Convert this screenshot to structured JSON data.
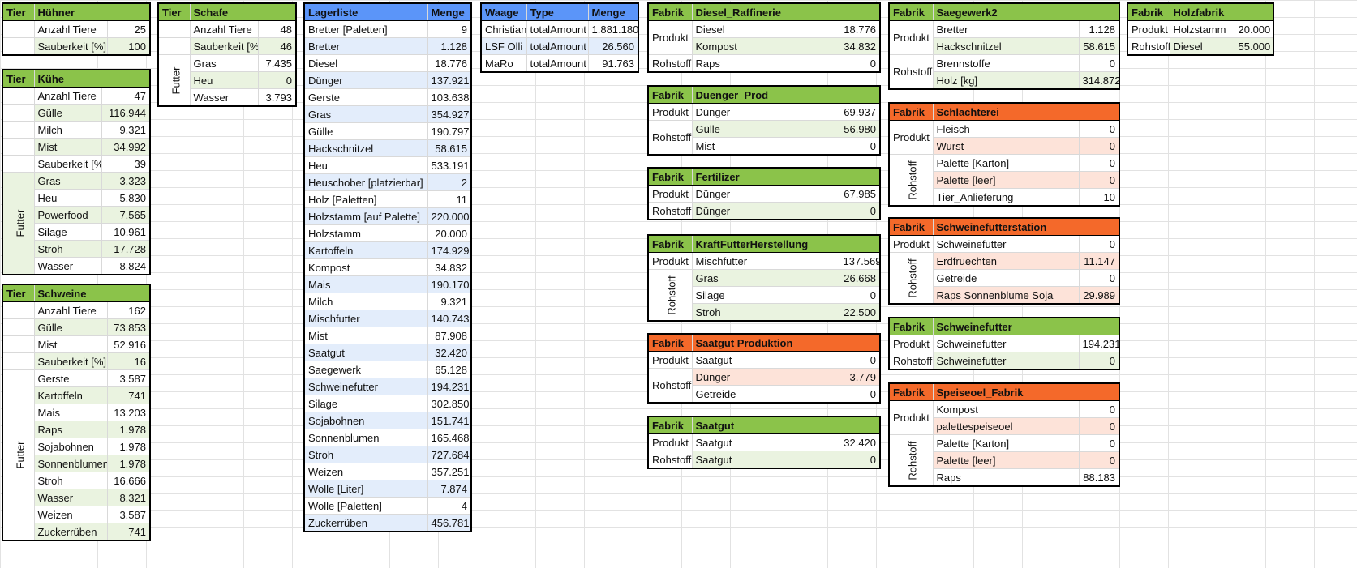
{
  "huehner": {
    "h1": "Tier",
    "h2": "Hühner",
    "rows": [
      [
        "Anzahl Tiere",
        "25"
      ],
      [
        "Sauberkeit [%]",
        "100"
      ]
    ]
  },
  "kuehe": {
    "h1": "Tier",
    "h2": "Kühe",
    "rows": [
      [
        "Anzahl Tiere",
        "47"
      ],
      [
        "Gülle",
        "116.944"
      ],
      [
        "Milch",
        "9.321"
      ],
      [
        "Mist",
        "34.992"
      ],
      [
        "Sauberkeit [%]",
        "39"
      ]
    ],
    "futter_label": "Futter",
    "futter": [
      [
        "Gras",
        "3.323"
      ],
      [
        "Heu",
        "5.830"
      ],
      [
        "Powerfood",
        "7.565"
      ],
      [
        "Silage",
        "10.961"
      ],
      [
        "Stroh",
        "17.728"
      ],
      [
        "Wasser",
        "8.824"
      ]
    ]
  },
  "schweine": {
    "h1": "Tier",
    "h2": "Schweine",
    "rows": [
      [
        "Anzahl Tiere",
        "162"
      ],
      [
        "Gülle",
        "73.853"
      ],
      [
        "Mist",
        "52.916"
      ],
      [
        "Sauberkeit [%]",
        "16"
      ]
    ],
    "futter_label": "Futter",
    "futter": [
      [
        "Gerste",
        "3.587"
      ],
      [
        "Kartoffeln",
        "741"
      ],
      [
        "Mais",
        "13.203"
      ],
      [
        "Raps",
        "1.978"
      ],
      [
        "Sojabohnen",
        "1.978"
      ],
      [
        "Sonnenblumen",
        "1.978"
      ],
      [
        "Stroh",
        "16.666"
      ],
      [
        "Wasser",
        "8.321"
      ],
      [
        "Weizen",
        "3.587"
      ],
      [
        "Zuckerrüben",
        "741"
      ]
    ]
  },
  "schafe": {
    "h1": "Tier",
    "h2": "Schafe",
    "rows": [
      [
        "Anzahl Tiere",
        "48"
      ],
      [
        "Sauberkeit [%]",
        "46"
      ]
    ],
    "futter_label": "Futter",
    "futter": [
      [
        "Gras",
        "7.435"
      ],
      [
        "Heu",
        "0"
      ],
      [
        "Wasser",
        "3.793"
      ]
    ]
  },
  "lager": {
    "h1": "Lagerliste",
    "h2": "Menge",
    "rows": [
      [
        "Bretter [Paletten]",
        "9"
      ],
      [
        "Bretter",
        "1.128"
      ],
      [
        "Diesel",
        "18.776"
      ],
      [
        "Dünger",
        "137.921"
      ],
      [
        "Gerste",
        "103.638"
      ],
      [
        "Gras",
        "354.927"
      ],
      [
        "Gülle",
        "190.797"
      ],
      [
        "Hackschnitzel",
        "58.615"
      ],
      [
        "Heu",
        "533.191"
      ],
      [
        "Heuschober [platzierbar]",
        "2"
      ],
      [
        "Holz [Paletten]",
        "11"
      ],
      [
        "Holzstamm [auf Palette]",
        "220.000"
      ],
      [
        "Holzstamm",
        "20.000"
      ],
      [
        "Kartoffeln",
        "174.929"
      ],
      [
        "Kompost",
        "34.832"
      ],
      [
        "Mais",
        "190.170"
      ],
      [
        "Milch",
        "9.321"
      ],
      [
        "Mischfutter",
        "140.743"
      ],
      [
        "Mist",
        "87.908"
      ],
      [
        "Saatgut",
        "32.420"
      ],
      [
        "Saegewerk",
        "65.128"
      ],
      [
        "Schweinefutter",
        "194.231"
      ],
      [
        "Silage",
        "302.850"
      ],
      [
        "Sojabohnen",
        "151.741"
      ],
      [
        "Sonnenblumen",
        "165.468"
      ],
      [
        "Stroh",
        "727.684"
      ],
      [
        "Weizen",
        "357.251"
      ],
      [
        "Wolle [Liter]",
        "7.874"
      ],
      [
        "Wolle [Paletten]",
        "4"
      ],
      [
        "Zuckerrüben",
        "456.781"
      ]
    ]
  },
  "waage": {
    "h1": "Waage",
    "h2": "Type",
    "h3": "Menge",
    "rows": [
      [
        "Christian",
        "totalAmount",
        "1.881.180"
      ],
      [
        "LSF Olli",
        "totalAmount",
        "26.560"
      ],
      [
        "MaRo",
        "totalAmount",
        "91.763"
      ]
    ]
  },
  "fabriken": {
    "diesel": {
      "h1": "Fabrik",
      "h2": "Diesel_Raffinerie",
      "produkt_label": "Produkt",
      "rohstoff_label": "Rohstoff",
      "produkt": [
        [
          "Diesel",
          "18.776"
        ],
        [
          "Kompost",
          "34.832"
        ]
      ],
      "rohstoff": [
        [
          "Raps",
          "0"
        ]
      ]
    },
    "duenger": {
      "h1": "Fabrik",
      "h2": "Duenger_Prod",
      "produkt_label": "Produkt",
      "rohstoff_label": "Rohstoff",
      "produkt": [
        [
          "Dünger",
          "69.937"
        ]
      ],
      "rohstoff": [
        [
          "Gülle",
          "56.980"
        ],
        [
          "Mist",
          "0"
        ]
      ]
    },
    "fert": {
      "h1": "Fabrik",
      "h2": "Fertilizer",
      "produkt_label": "Produkt",
      "rohstoff_label": "Rohstoff",
      "produkt": [
        [
          "Dünger",
          "67.985"
        ]
      ],
      "rohstoff": [
        [
          "Dünger",
          "0"
        ]
      ]
    },
    "kraft": {
      "h1": "Fabrik",
      "h2": "KraftFutterHerstellung",
      "produkt_label": "Produkt",
      "rohstoff_label": "Rohstoff",
      "produkt": [
        [
          "Mischfutter",
          "137.569"
        ]
      ],
      "rohstoff": [
        [
          "Gras",
          "26.668"
        ],
        [
          "Silage",
          "0"
        ],
        [
          "Stroh",
          "22.500"
        ]
      ]
    },
    "saatprod": {
      "h1": "Fabrik",
      "h2": "Saatgut Produktion",
      "produkt_label": "Produkt",
      "rohstoff_label": "Rohstoff",
      "produkt": [
        [
          "Saatgut",
          "0"
        ]
      ],
      "rohstoff": [
        [
          "Dünger",
          "3.779"
        ],
        [
          "Getreide",
          "0"
        ]
      ]
    },
    "saatgut": {
      "h1": "Fabrik",
      "h2": "Saatgut",
      "produkt_label": "Produkt",
      "rohstoff_label": "Rohstoff",
      "produkt": [
        [
          "Saatgut",
          "32.420"
        ]
      ],
      "rohstoff": [
        [
          "Saatgut",
          "0"
        ]
      ]
    },
    "saege": {
      "h1": "Fabrik",
      "h2": "Saegewerk2",
      "produkt_label": "Produkt",
      "rohstoff_label": "Rohstoff",
      "produkt": [
        [
          "Bretter",
          "1.128"
        ],
        [
          "Hackschnitzel",
          "58.615"
        ]
      ],
      "rohstoff": [
        [
          "Brennstoffe",
          "0"
        ],
        [
          "Holz [kg]",
          "314.872"
        ]
      ]
    },
    "schlacht": {
      "h1": "Fabrik",
      "h2": "Schlachterei",
      "produkt_label": "Produkt",
      "rohstoff_label": "Rohstoff",
      "produkt": [
        [
          "Fleisch",
          "0"
        ],
        [
          "Wurst",
          "0"
        ]
      ],
      "rohstoff": [
        [
          "Palette [Karton]",
          "0"
        ],
        [
          "Palette [leer]",
          "0"
        ],
        [
          "Tier_Anlieferung",
          "10"
        ]
      ]
    },
    "sfstation": {
      "h1": "Fabrik",
      "h2": "Schweinefutterstation",
      "produkt_label": "Produkt",
      "rohstoff_label": "Rohstoff",
      "produkt": [
        [
          "Schweinefutter",
          "0"
        ]
      ],
      "rohstoff": [
        [
          "Erdfruechten",
          "11.147"
        ],
        [
          "Getreide",
          "0"
        ],
        [
          "Raps Sonnenblume Soja",
          "29.989"
        ]
      ]
    },
    "sfutter": {
      "h1": "Fabrik",
      "h2": "Schweinefutter",
      "produkt_label": "Produkt",
      "rohstoff_label": "Rohstoff",
      "produkt": [
        [
          "Schweinefutter",
          "194.231"
        ]
      ],
      "rohstoff": [
        [
          "Schweinefutter",
          "0"
        ]
      ]
    },
    "speise": {
      "h1": "Fabrik",
      "h2": "Speiseoel_Fabrik",
      "produkt_label": "Produkt",
      "rohstoff_label": "Rohstoff",
      "produkt": [
        [
          "Kompost",
          "0"
        ],
        [
          "palettespeiseoel",
          "0"
        ]
      ],
      "rohstoff": [
        [
          "Palette [Karton]",
          "0"
        ],
        [
          "Palette [leer]",
          "0"
        ],
        [
          "Raps",
          "88.183"
        ]
      ]
    },
    "holz": {
      "h1": "Fabrik",
      "h2": "Holzfabrik",
      "produkt_label": "Produkt",
      "rohstoff_label": "Rohstoff",
      "produkt": [
        [
          "Holzstamm",
          "20.000"
        ]
      ],
      "rohstoff": [
        [
          "Diesel",
          "55.000"
        ]
      ]
    }
  },
  "colors": {
    "green": "#8bc34a",
    "blue": "#5b95f9",
    "orange": "#f4692a",
    "grid": "#e2e2e2"
  }
}
